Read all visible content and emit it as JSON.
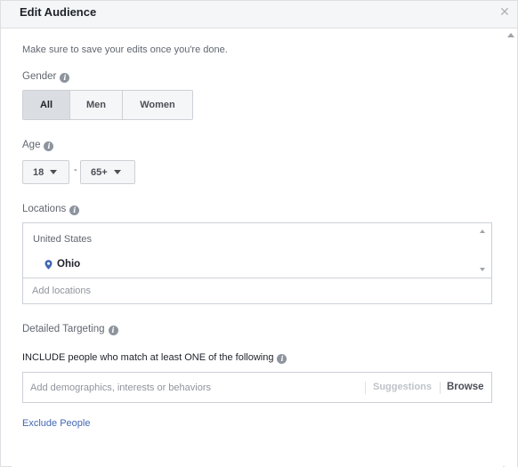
{
  "dialog": {
    "title": "Edit Audience",
    "close_icon": "close-icon",
    "note": "Make sure to save your edits once you're done."
  },
  "gender": {
    "label": "Gender",
    "options": [
      "All",
      "Men",
      "Women"
    ],
    "selected": "All"
  },
  "age": {
    "label": "Age",
    "min": "18",
    "max": "65+",
    "separator": "-"
  },
  "locations": {
    "label": "Locations",
    "country": "United States",
    "items": [
      "Ohio"
    ],
    "placeholder": "Add locations"
  },
  "detailed_targeting": {
    "label": "Detailed Targeting",
    "include_label": "INCLUDE people who match at least ONE of the following",
    "placeholder": "Add demographics, interests or behaviors",
    "suggestions_label": "Suggestions",
    "browse_label": "Browse"
  },
  "exclude_link": "Exclude People",
  "colors": {
    "accent_link": "#4267b2",
    "pin": "#4267b2",
    "selected_segment": "#dadde1"
  },
  "icons": {
    "info": "info-icon",
    "pin": "location-pin-icon",
    "caret": "caret-down-icon"
  }
}
